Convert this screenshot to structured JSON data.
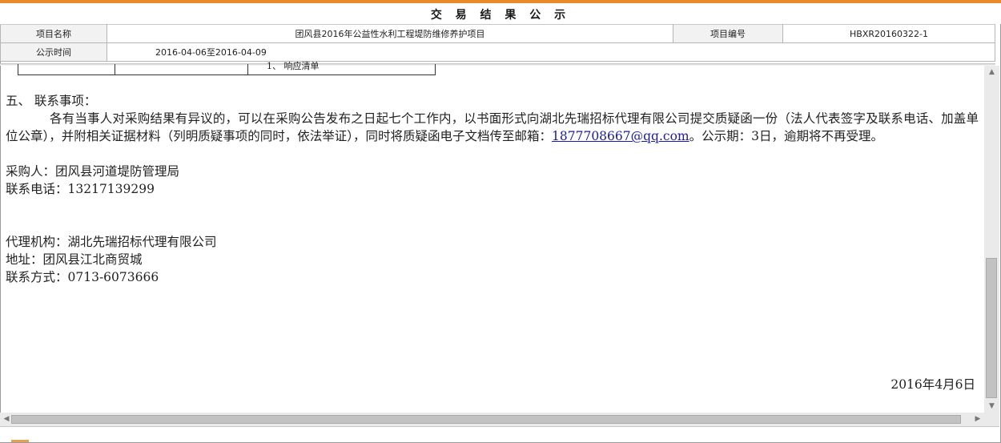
{
  "window": {
    "title": "交 易 结 果 公 示",
    "accent_color": "#e8892b"
  },
  "info": {
    "project_name_label": "项目名称",
    "project_name": "团风县2016年公益性水利工程堤防维修养护项目",
    "project_no_label": "项目编号",
    "project_no": "HBXR20160322-1",
    "publicity_time_label": "公示时间",
    "publicity_time": "2016-04-06至2016-04-09"
  },
  "partial_table_text": "1、 响应清单",
  "contact": {
    "heading": "五、  联系事项：",
    "para1_start": "各有当事人对采购结果有异议的，可以在采购公告发布之日起七个工作内，以书面形式向湖北先瑞招标代理有限公司提交质疑函一份（法人代表签字及联系电话、加盖单位公章），并附相关证据材料（列明质疑事项的同时，依法举证），同时将质疑函电子文档传至邮箱：",
    "email": "1877708667@qq.com",
    "para1_end": "。公示期：3日，逾期将不再受理。",
    "purchaser": "采购人：团风县河道堤防管理局",
    "purchaser_phone": "联系电话：13217139299",
    "agency": "代理机构：湖北先瑞招标代理有限公司",
    "address": "地址：团风县江北商贸城",
    "contact_method": "联系方式：0713-6073666"
  },
  "date": "2016年4月6日",
  "icons": {
    "scroll_up": "▲",
    "scroll_down": "▼",
    "scroll_left": "◀",
    "scroll_right": "▶"
  }
}
